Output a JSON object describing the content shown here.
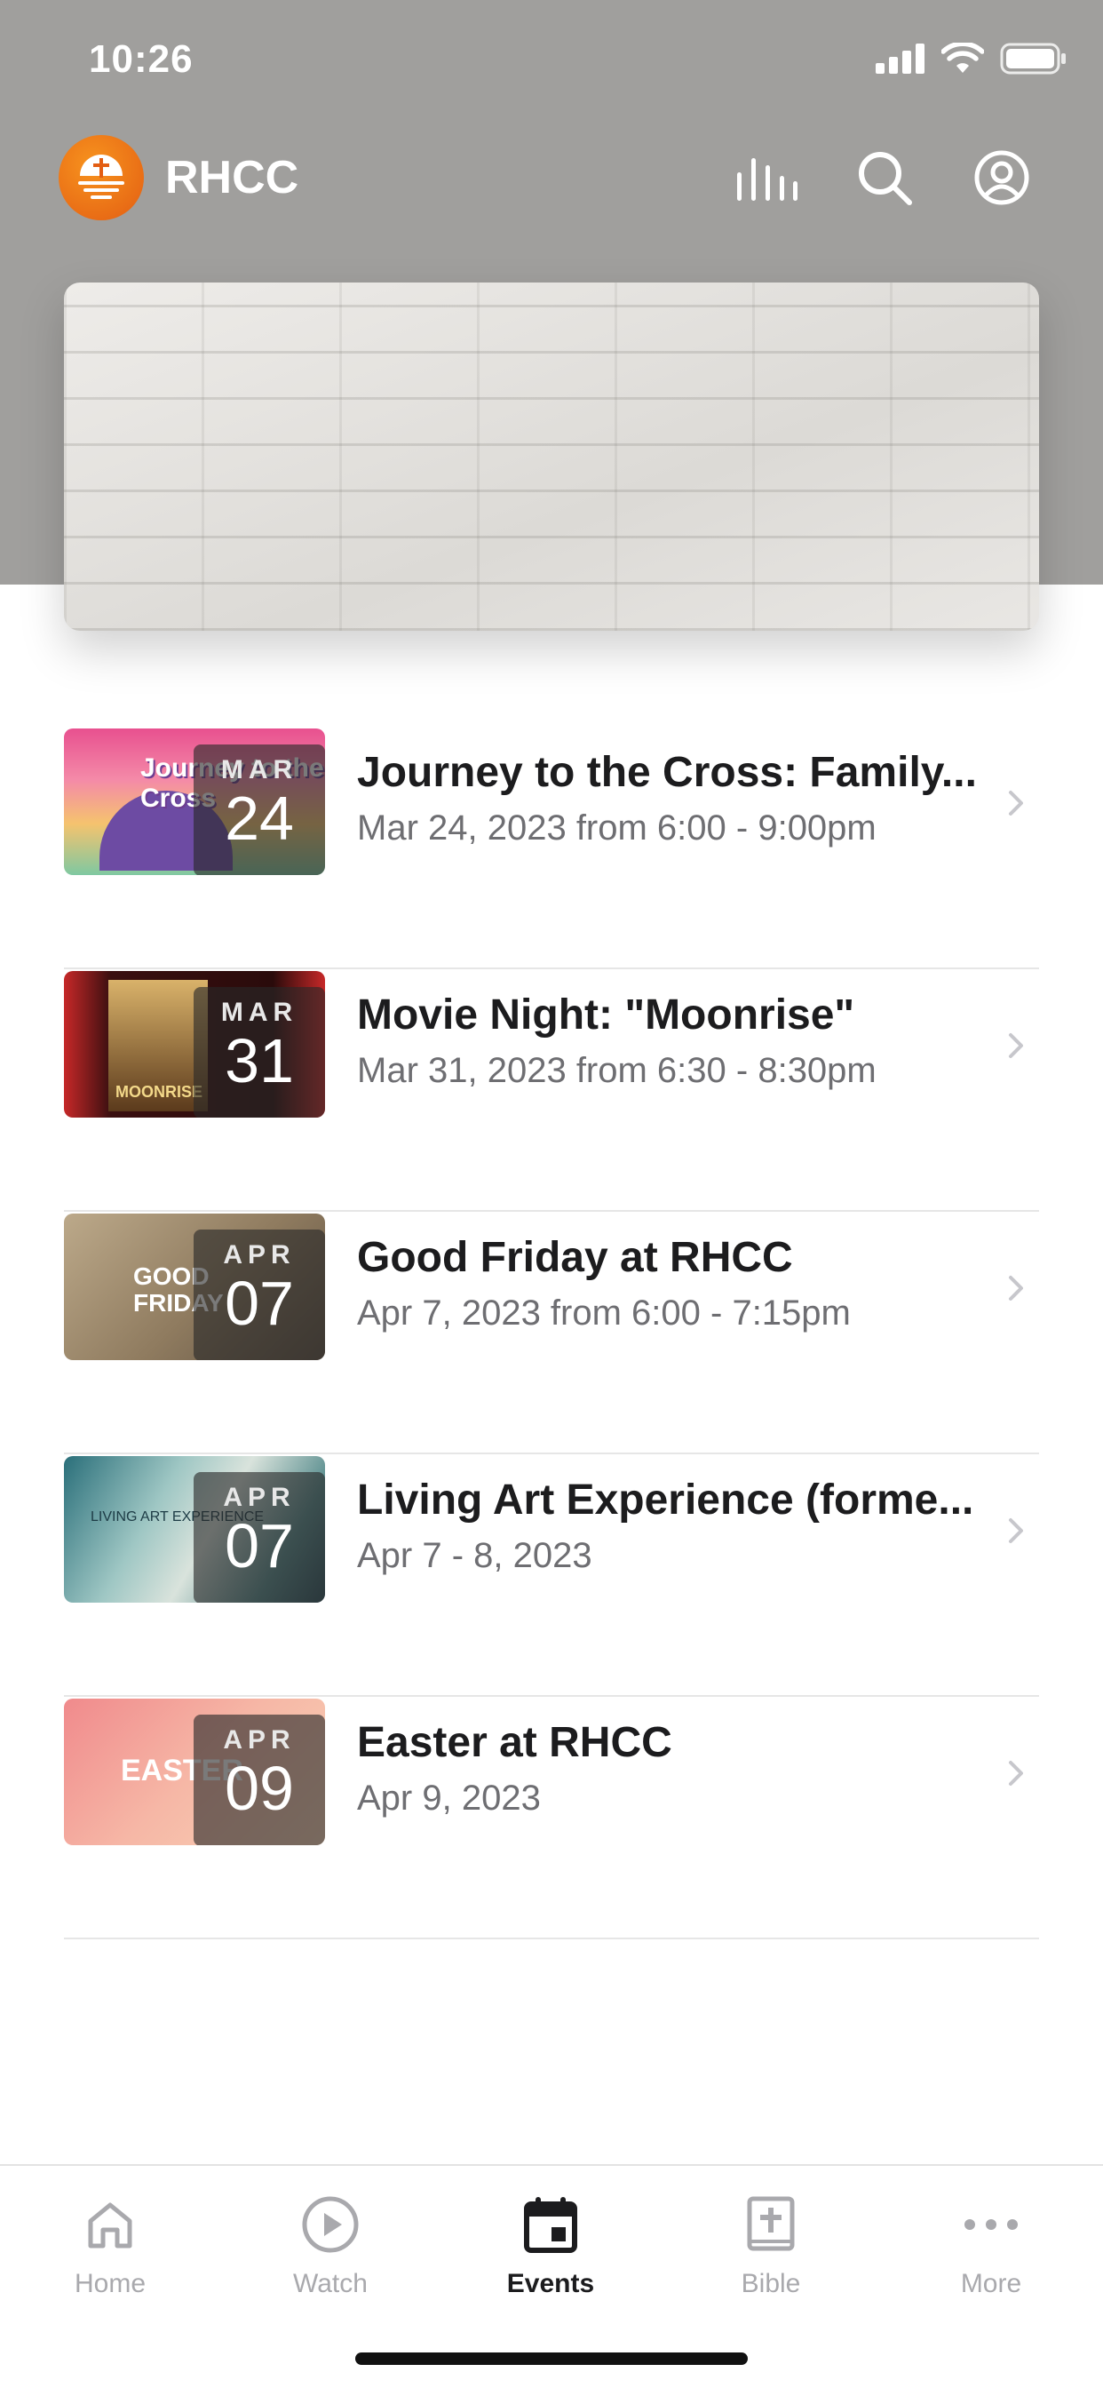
{
  "status_bar": {
    "time": "10:26"
  },
  "header": {
    "brand": "RHCC",
    "icons": {
      "audio": "audio-bars-icon",
      "search": "search-icon",
      "profile": "profile-icon"
    }
  },
  "banner": {
    "image": "white-brick-wall"
  },
  "events": [
    {
      "title": "Journey to the Cross: Family...",
      "date": "Mar 24, 2023 from 6:00 - 9:00pm",
      "month": "MAR",
      "day": "24",
      "thumb_text": "Journey to the Cross"
    },
    {
      "title": "Movie Night: \"Moonrise\"",
      "date": "Mar 31, 2023 from 6:30 - 8:30pm",
      "month": "MAR",
      "day": "31",
      "thumb_text": "MOONRISE"
    },
    {
      "title": "Good Friday at RHCC",
      "date": "Apr 7, 2023 from 6:00 - 7:15pm",
      "month": "APR",
      "day": "07",
      "thumb_text": "GOOD FRIDAY"
    },
    {
      "title": "Living Art Experience (forme...",
      "date": "Apr 7 - 8, 2023",
      "month": "APR",
      "day": "07",
      "thumb_text": "LIVING ART EXPERIENCE"
    },
    {
      "title": "Easter at RHCC",
      "date": "Apr 9, 2023",
      "month": "APR",
      "day": "09",
      "thumb_text": "EASTER"
    }
  ],
  "tabs": [
    {
      "label": "Home",
      "icon": "home-icon"
    },
    {
      "label": "Watch",
      "icon": "play-icon"
    },
    {
      "label": "Events",
      "icon": "calendar-icon",
      "active": true
    },
    {
      "label": "Bible",
      "icon": "bible-icon"
    },
    {
      "label": "More",
      "icon": "more-icon"
    }
  ],
  "colors": {
    "header_bg": "#a09f9d",
    "logo": "#ef7a1a",
    "active_tab": "#1c1c1e",
    "inactive_tab": "#a9a9ad"
  }
}
